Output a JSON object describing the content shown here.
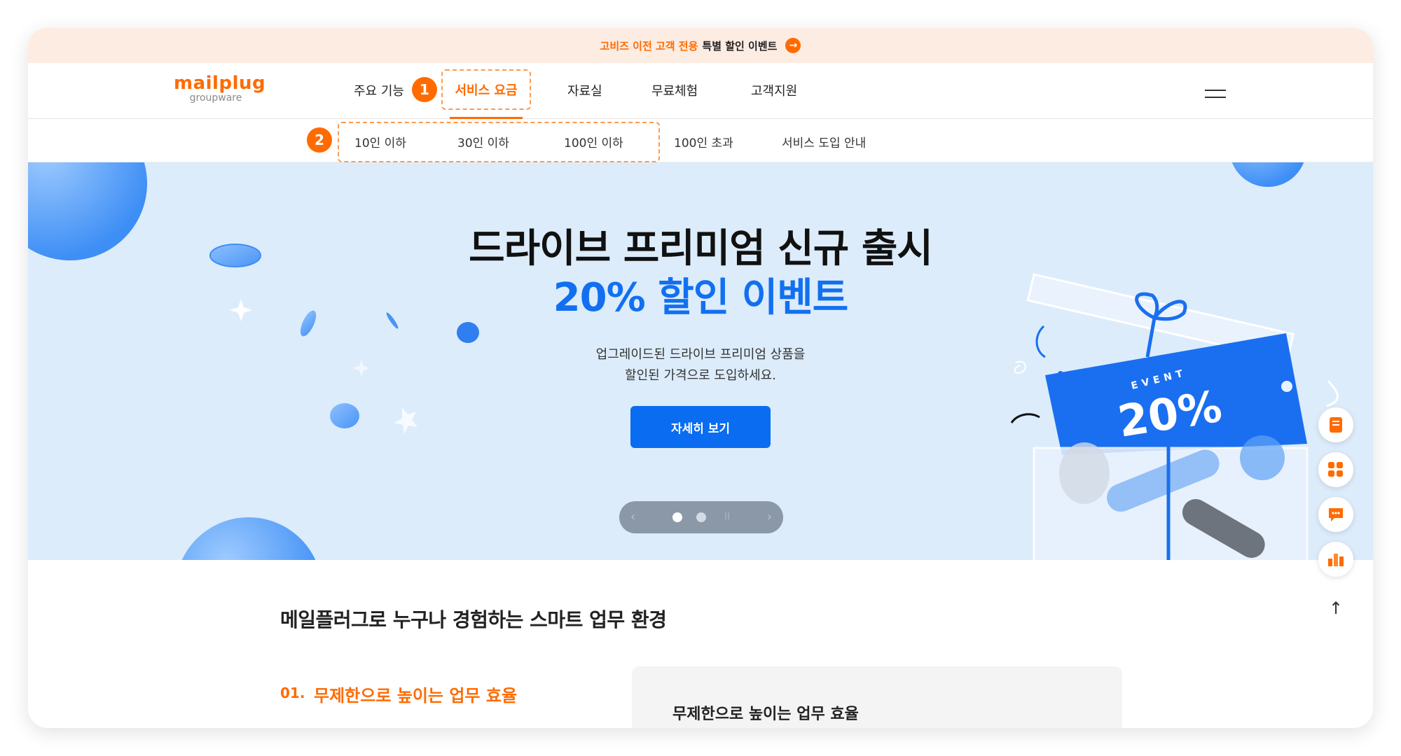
{
  "promo": {
    "text_accent": "고비즈 이전 고객 전용",
    "text_dark": "특별 할인 이벤트",
    "arrow": "→"
  },
  "logo": {
    "main": "mailplug",
    "sub": "groupware"
  },
  "nav": {
    "items": [
      "주요 기능",
      "서비스 요금",
      "자료실",
      "무료체험",
      "고객지원"
    ],
    "badges": [
      "1",
      "2"
    ]
  },
  "subnav": {
    "items": [
      "10인 이하",
      "30인 이하",
      "100인 이하",
      "100인 초과",
      "서비스 도입 안내"
    ]
  },
  "hero": {
    "title": "드라이브 프리미엄 신규 출시",
    "subtitle": "20% 할인 이벤트",
    "desc_line1": "업그레이드된 드라이브 프리미엄 상품을",
    "desc_line2": "할인된 가격으로 도입하세요.",
    "cta": "자세히 보기",
    "event_label": "EVENT",
    "event_value": "20%"
  },
  "pager": {
    "prev": "‹",
    "next": "›",
    "pause": "II",
    "active_index": 0
  },
  "floating": {
    "icons": [
      "document-icon",
      "apps-icon",
      "chat-icon",
      "chart-icon",
      "arrow-up-icon"
    ],
    "up_symbol": "↑"
  },
  "section": {
    "title": "메일플러그로 누구나 경험하는 스마트 업무 환경",
    "feature_num": "01.",
    "feature_label": "무제한으로 높이는 업무 효율",
    "card_title": "무제한으로 높이는 업무 효율"
  },
  "colors": {
    "accent": "#ff6b00",
    "brand_blue": "#0a6cf0",
    "hero_bg": "#dcecfb",
    "promo_bg": "#fdece2"
  }
}
